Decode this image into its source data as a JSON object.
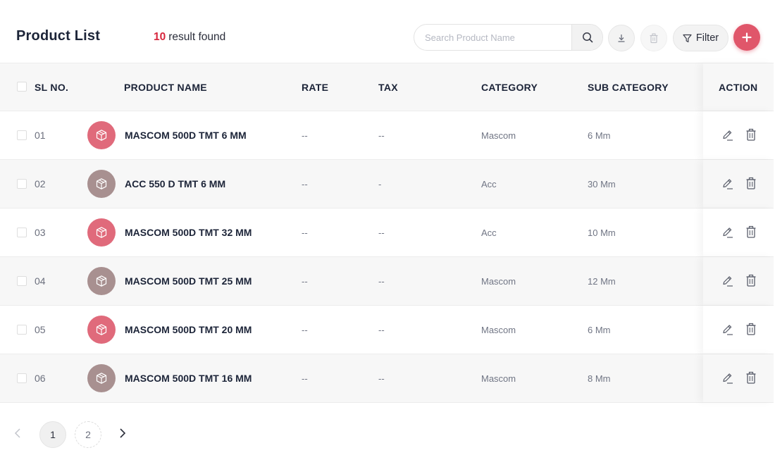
{
  "header": {
    "title": "Product List",
    "result_count": "10",
    "result_text": "result found",
    "search_placeholder": "Search Product Name",
    "filter_label": "Filter"
  },
  "table": {
    "columns": {
      "sl": "SL NO.",
      "product_name": "PRODUCT NAME",
      "rate": "RATE",
      "tax": "TAX",
      "category": "CATEGORY",
      "sub_category": "SUB CATEGORY",
      "action": "ACTION"
    },
    "rows": [
      {
        "sl": "01",
        "name": "MASCOM 500D TMT 6 MM",
        "rate": "--",
        "tax": "--",
        "category": "Mascom",
        "sub_category": "6 Mm",
        "avatar_color": "#e06a7b"
      },
      {
        "sl": "02",
        "name": "ACC 550 D TMT 6 MM",
        "rate": "--",
        "tax": "-",
        "category": "Acc",
        "sub_category": "30 Mm",
        "avatar_color": "#a89090"
      },
      {
        "sl": "03",
        "name": "MASCOM 500D TMT 32 MM",
        "rate": "--",
        "tax": "--",
        "category": "Acc",
        "sub_category": "10 Mm",
        "avatar_color": "#e06a7b"
      },
      {
        "sl": "04",
        "name": "MASCOM 500D TMT 25 MM",
        "rate": "--",
        "tax": "--",
        "category": "Mascom",
        "sub_category": "12 Mm",
        "avatar_color": "#a89090"
      },
      {
        "sl": "05",
        "name": "MASCOM 500D TMT 20 MM",
        "rate": "--",
        "tax": "--",
        "category": "Mascom",
        "sub_category": "6 Mm",
        "avatar_color": "#e06a7b"
      },
      {
        "sl": "06",
        "name": "MASCOM 500D TMT 16 MM",
        "rate": "--",
        "tax": "--",
        "category": "Mascom",
        "sub_category": "8 Mm",
        "avatar_color": "#a89090"
      }
    ]
  },
  "pagination": {
    "pages": [
      "1",
      "2"
    ],
    "current": "1"
  },
  "colors": {
    "accent": "#e0566a",
    "count_red": "#d7263d",
    "avatar_pink": "#e06a7b",
    "avatar_taupe": "#a89090"
  },
  "icons": {
    "search": "search-icon",
    "download": "download-icon",
    "delete": "trash-icon",
    "filter": "filter-icon",
    "add": "plus-icon",
    "edit": "edit-pencil-icon",
    "product": "box-icon"
  }
}
